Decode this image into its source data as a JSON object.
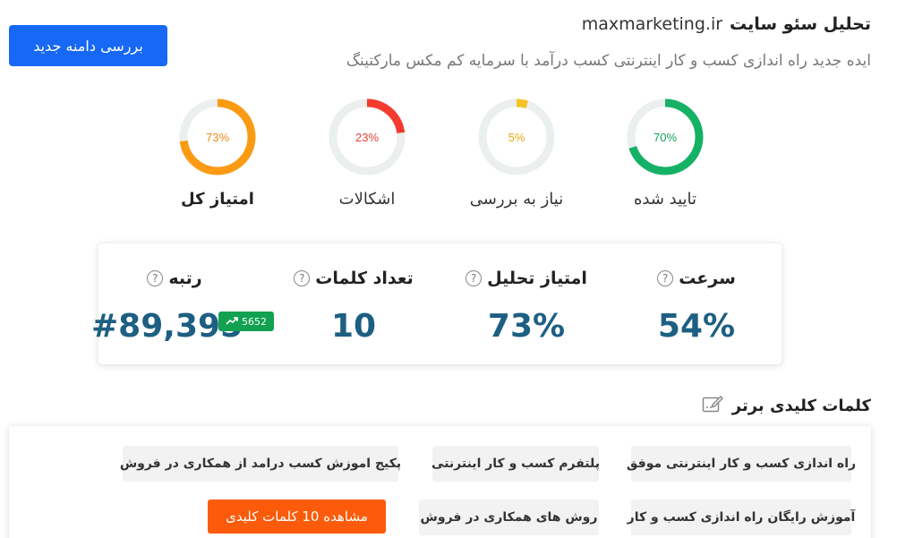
{
  "header": {
    "title": "تحلیل سئو سایت",
    "domain": "maxmarketing.ir",
    "subtitle": "ایده جدید راه اندازی کسب و کار اینترنتی کسب درآمد با سرمایه کم مکس مارکتینگ",
    "new_domain_button": "بررسی دامنه جدید"
  },
  "gauges": [
    {
      "label": "تایید شده",
      "value_text": "70%",
      "value": 70,
      "color": "#15b266",
      "text_color": "#15a35e"
    },
    {
      "label": "نیاز به بررسی",
      "value_text": "5%",
      "value": 5,
      "color": "#f5c32a",
      "text_color": "#e8a912"
    },
    {
      "label": "اشکالات",
      "value_text": "23%",
      "value": 23,
      "color": "#f53b2e",
      "text_color": "#e64234"
    },
    {
      "label": "امتیاز کل",
      "value_text": "73%",
      "value": 73,
      "color": "#fb9b14",
      "text_color": "#f08a1b"
    }
  ],
  "track_color": "#ebefed",
  "stats": {
    "speed_label": "سرعت",
    "speed_value": "54%",
    "analysis_label": "امتیاز تحلیل",
    "analysis_value": "73%",
    "words_label": "تعداد کلمات",
    "words_value": "10",
    "rank_label": "رتبه",
    "rank_value": "#89,395",
    "rank_change": "5652",
    "help_symbol": "?"
  },
  "keywords": {
    "title": "کلمات کلیدی برتر",
    "items": [
      "راه اندازی کسب و کار اینترنتی موفق",
      "پلتفرم کسب و کار اینترنتی",
      "پکیج اموزش کسب درامد از همکاری در فروش",
      "آموزش رایگان راه اندازی کسب و کار",
      "روش های همکاری در فروش"
    ],
    "more_button": "مشاهده 10 کلمات کلیدی"
  }
}
